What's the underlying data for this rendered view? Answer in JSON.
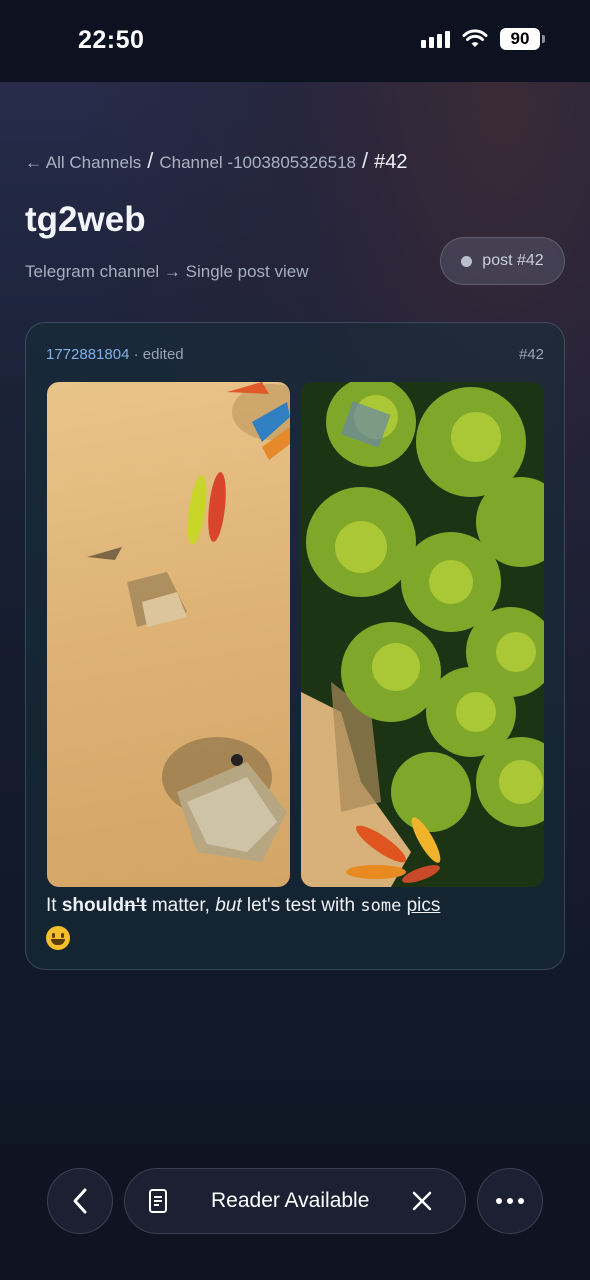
{
  "status": {
    "time": "22:50",
    "battery": "90"
  },
  "breadcrumb": {
    "back_link": "← All Channels",
    "sep": "/",
    "channel": "Channel -1003805326518",
    "current": "#42"
  },
  "header": {
    "title": "tg2web",
    "subtitle": "Telegram channel → Single post view",
    "post_pill": "post #42"
  },
  "post": {
    "author": "1772881804",
    "edited": "· edited",
    "number": "#42",
    "text": {
      "t1": "It ",
      "bold": "should",
      "strike": "n't",
      "t2": " matter, ",
      "italic": "but",
      "t3": " let's test with ",
      "mono": "some",
      "t4": " ",
      "link": "pics"
    },
    "images": [
      "photo-beach-sand-boats",
      "photo-palm-trees-beach"
    ]
  },
  "toolbar": {
    "reader_label": "Reader Available"
  },
  "icons": [
    "back-chevron-icon",
    "reader-icon",
    "close-icon",
    "more-icon",
    "wifi-icon",
    "signal-icon"
  ]
}
